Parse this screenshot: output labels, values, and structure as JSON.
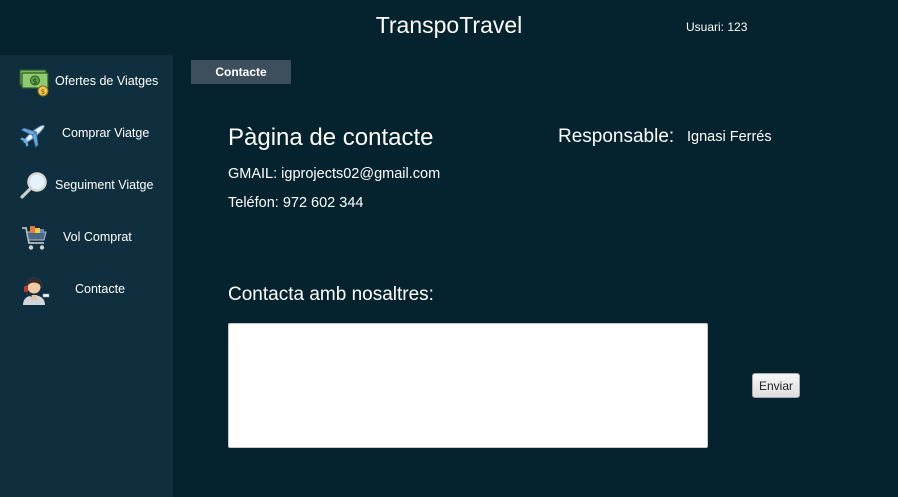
{
  "header": {
    "title": "TranspoTravel",
    "user_info": "Usuari: 123"
  },
  "sidebar": {
    "items": [
      {
        "label": "Ofertes de Viatges",
        "icon": "money-icon"
      },
      {
        "label": "Comprar Viatge",
        "icon": "airplane-icon"
      },
      {
        "label": "Seguiment Viatge",
        "icon": "magnifier-icon"
      },
      {
        "label": "Vol Comprat",
        "icon": "shopping-cart-icon"
      },
      {
        "label": "Contacte",
        "icon": "support-agent-icon"
      }
    ]
  },
  "tab": {
    "label": "Contacte"
  },
  "main": {
    "title": "Pàgina de contacte",
    "email": "GMAIL: igprojects02@gmail.com",
    "phone": "Teléfon: 972 602 344",
    "responsible_label": "Responsable:",
    "responsible_name": "Ignasi Ferrés",
    "contact_heading": "Contacta amb nosaltres:",
    "message_value": "",
    "send_label": "Enviar"
  },
  "colors": {
    "background": "#05232f",
    "sidebar": "#0f2f3f",
    "tab": "#3d4f5d",
    "text": "#ffffff"
  }
}
